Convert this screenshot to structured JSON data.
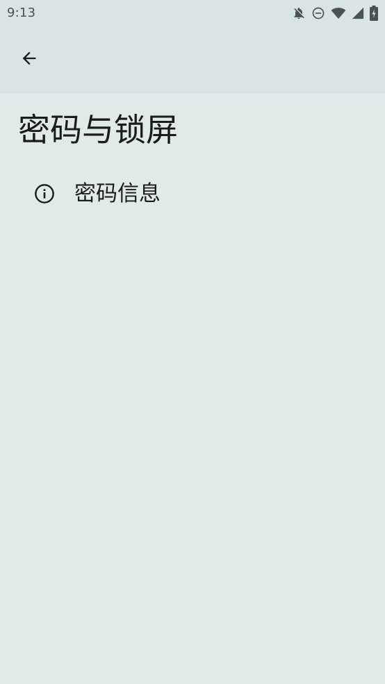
{
  "status_bar": {
    "time": "9:13",
    "icons": [
      "notifications-off-icon",
      "do-not-disturb-icon",
      "wifi-icon",
      "cellular-signal-icon",
      "battery-charging-icon"
    ]
  },
  "app_bar": {
    "back_icon": "arrow-back-icon"
  },
  "page": {
    "title": "密码与锁屏",
    "items": [
      {
        "label": "密码信息",
        "icon": "info-icon"
      }
    ]
  },
  "colors": {
    "background": "#e1eaeb",
    "app_bar": "#d8e5e6",
    "text": "#191c1d",
    "status_text": "#4a5254"
  }
}
